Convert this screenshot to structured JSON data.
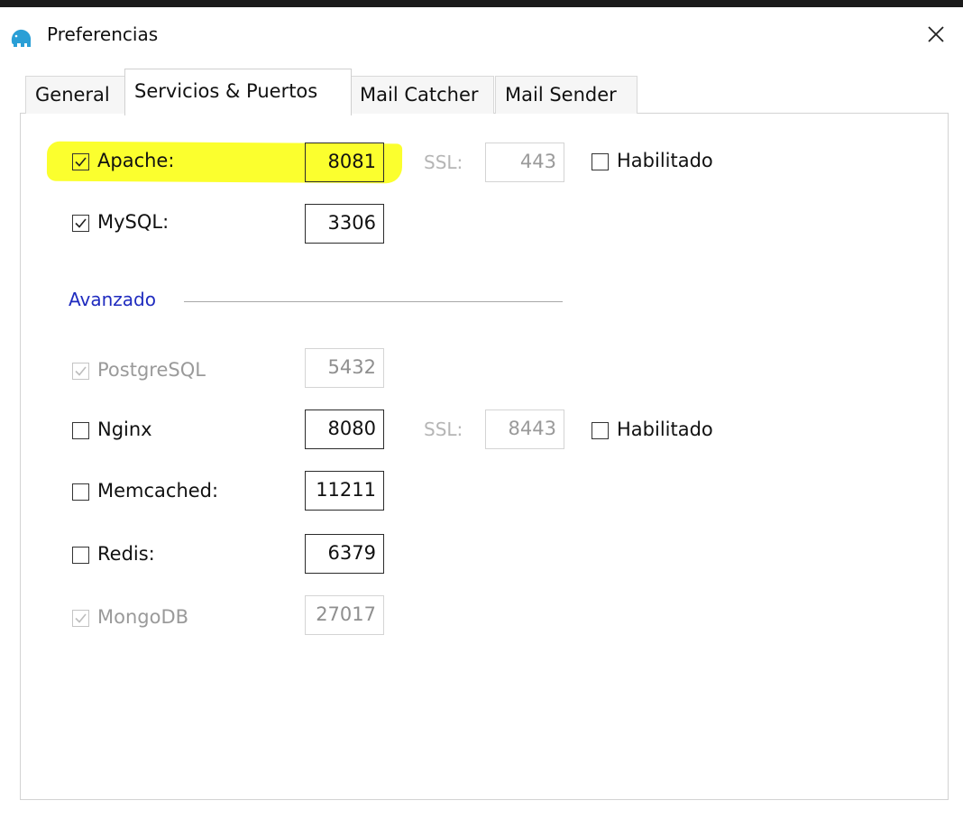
{
  "window": {
    "title": "Preferencias"
  },
  "tabs": [
    {
      "label": "General",
      "active": false
    },
    {
      "label": "Servicios & Puertos",
      "active": true
    },
    {
      "label": "Mail Catcher",
      "active": false
    },
    {
      "label": "Mail Sender",
      "active": false
    }
  ],
  "services": {
    "apache": {
      "label": "Apache:",
      "checked": true,
      "enabled": true,
      "port": "8081",
      "ssl_label": "SSL:",
      "ssl_port": "443",
      "ssl_enabled_label": "Habilitado",
      "ssl_checked": false
    },
    "mysql": {
      "label": "MySQL:",
      "checked": true,
      "enabled": true,
      "port": "3306"
    }
  },
  "advanced": {
    "title": "Avanzado",
    "postgresql": {
      "label": "PostgreSQL",
      "checked": true,
      "enabled": false,
      "port": "5432"
    },
    "nginx": {
      "label": "Nginx",
      "checked": false,
      "enabled": true,
      "port": "8080",
      "ssl_label": "SSL:",
      "ssl_port": "8443",
      "ssl_enabled_label": "Habilitado",
      "ssl_checked": false
    },
    "memcached": {
      "label": "Memcached:",
      "checked": false,
      "enabled": true,
      "port": "11211"
    },
    "redis": {
      "label": "Redis:",
      "checked": false,
      "enabled": true,
      "port": "6379"
    },
    "mongodb": {
      "label": "MongoDB",
      "checked": true,
      "enabled": false,
      "port": "27017"
    }
  },
  "colors": {
    "highlight": "#fbff2e",
    "group_title": "#1f2bbf",
    "app_icon": "#2a9fd6"
  },
  "icons": {
    "app": "elephant-icon",
    "close": "close-icon",
    "checkmark": "checkmark-icon"
  }
}
